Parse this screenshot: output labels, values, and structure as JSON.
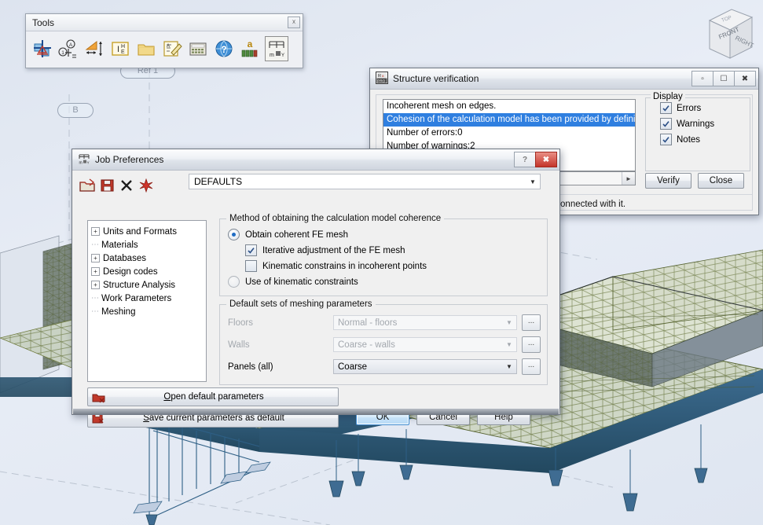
{
  "viewport": {
    "labels": [
      {
        "text": "Ref 1"
      },
      {
        "text": "B"
      }
    ],
    "viewcube": {
      "front_face": "FRONT",
      "right_face": "RIGHT",
      "top_face": "TOP"
    },
    "background_color": "#e3e9f3",
    "mesh_color": "#6e7a3c",
    "member_color": "#2e5f85"
  },
  "tools_palette": {
    "title": "Tools",
    "close_icon": "close-icon",
    "buttons": [
      {
        "name": "structure-model-icon",
        "label": ""
      },
      {
        "name": "node-numbering-icon",
        "label": ""
      },
      {
        "name": "dimension-icon",
        "label": ""
      },
      {
        "name": "section-icon",
        "label": ""
      },
      {
        "name": "open-folder-icon",
        "label": ""
      },
      {
        "name": "edit-notes-icon",
        "label": ""
      },
      {
        "name": "calculator-icon",
        "label": ""
      },
      {
        "name": "help-globe-icon",
        "label": ""
      },
      {
        "name": "text-scale-icon",
        "label": "a"
      },
      {
        "name": "units-icon",
        "label": "m"
      }
    ]
  },
  "verify_window": {
    "title": "Structure verification",
    "app_icon": "robot-pro-icon",
    "controls": {
      "minimize": "–",
      "restore": "▭",
      "close": "✖"
    },
    "messages": [
      {
        "text": "Incoherent mesh on edges.",
        "selected": false
      },
      {
        "text": "Cohesion of the calculation model has been provided by definition o",
        "selected": true
      },
      {
        "text": "Number of errors:0",
        "selected": false
      },
      {
        "text": "Number of warnings:2",
        "selected": false
      }
    ],
    "display_group": {
      "legend": "Display",
      "options": [
        {
          "label": "Errors",
          "checked": true
        },
        {
          "label": "Warnings",
          "checked": true
        },
        {
          "label": "Notes",
          "checked": true
        }
      ]
    },
    "buttons": [
      {
        "label": "Verify"
      },
      {
        "label": "Close"
      }
    ],
    "note": "Selection of error or warning selects objects connected with it.",
    "selection_color": "#2f7fe0"
  },
  "job_preferences": {
    "title": "Job Preferences",
    "app_icon": "units-icon",
    "controls": {
      "help": "?",
      "close": "✖"
    },
    "toolbar_icons": [
      {
        "name": "open-preferences-icon"
      },
      {
        "name": "save-preferences-icon"
      },
      {
        "name": "delete-preferences-icon"
      },
      {
        "name": "default-preferences-icon"
      }
    ],
    "profile_combo": {
      "value": "DEFAULTS",
      "arrow": "▼"
    },
    "tree": [
      {
        "label": "Units and Formats",
        "expandable": true,
        "selected": false
      },
      {
        "label": "Materials",
        "expandable": false,
        "selected": false
      },
      {
        "label": "Databases",
        "expandable": true,
        "selected": false
      },
      {
        "label": "Design codes",
        "expandable": true,
        "selected": false
      },
      {
        "label": "Structure Analysis",
        "expandable": true,
        "selected": false
      },
      {
        "label": "Work Parameters",
        "expandable": false,
        "selected": false
      },
      {
        "label": "Meshing",
        "expandable": false,
        "selected": false
      }
    ],
    "coherence_group": {
      "legend": "Method of obtaining the calculation model coherence",
      "radio_coherent": {
        "label": "Obtain coherent FE mesh",
        "selected": true
      },
      "check_iterative": {
        "label": "Iterative adjustment of the FE mesh",
        "checked": true,
        "enabled": true
      },
      "check_kinematic": {
        "label": "Kinematic constrains in incoherent points",
        "checked": false,
        "enabled": true
      },
      "radio_kinematic": {
        "label": "Use of kinematic constraints",
        "selected": false
      }
    },
    "meshing_group": {
      "legend": "Default sets of meshing parameters",
      "rows": [
        {
          "label": "Floors",
          "value": "Normal - floors",
          "enabled": false,
          "dots": "..."
        },
        {
          "label": "Walls",
          "value": "Coarse - walls",
          "enabled": false,
          "dots": "..."
        },
        {
          "label": "Panels (all)",
          "value": "Coarse",
          "enabled": true,
          "dots": "..."
        }
      ]
    },
    "default_buttons": [
      {
        "label": "Open default parameters",
        "accel": "O",
        "icon": "open-default-icon"
      },
      {
        "label": "Save current parameters as default",
        "accel": "S",
        "icon": "save-default-icon"
      }
    ],
    "actions": [
      {
        "label": "OK",
        "primary": true
      },
      {
        "label": "Cancel",
        "primary": false
      },
      {
        "label": "Help",
        "primary": false
      }
    ]
  }
}
